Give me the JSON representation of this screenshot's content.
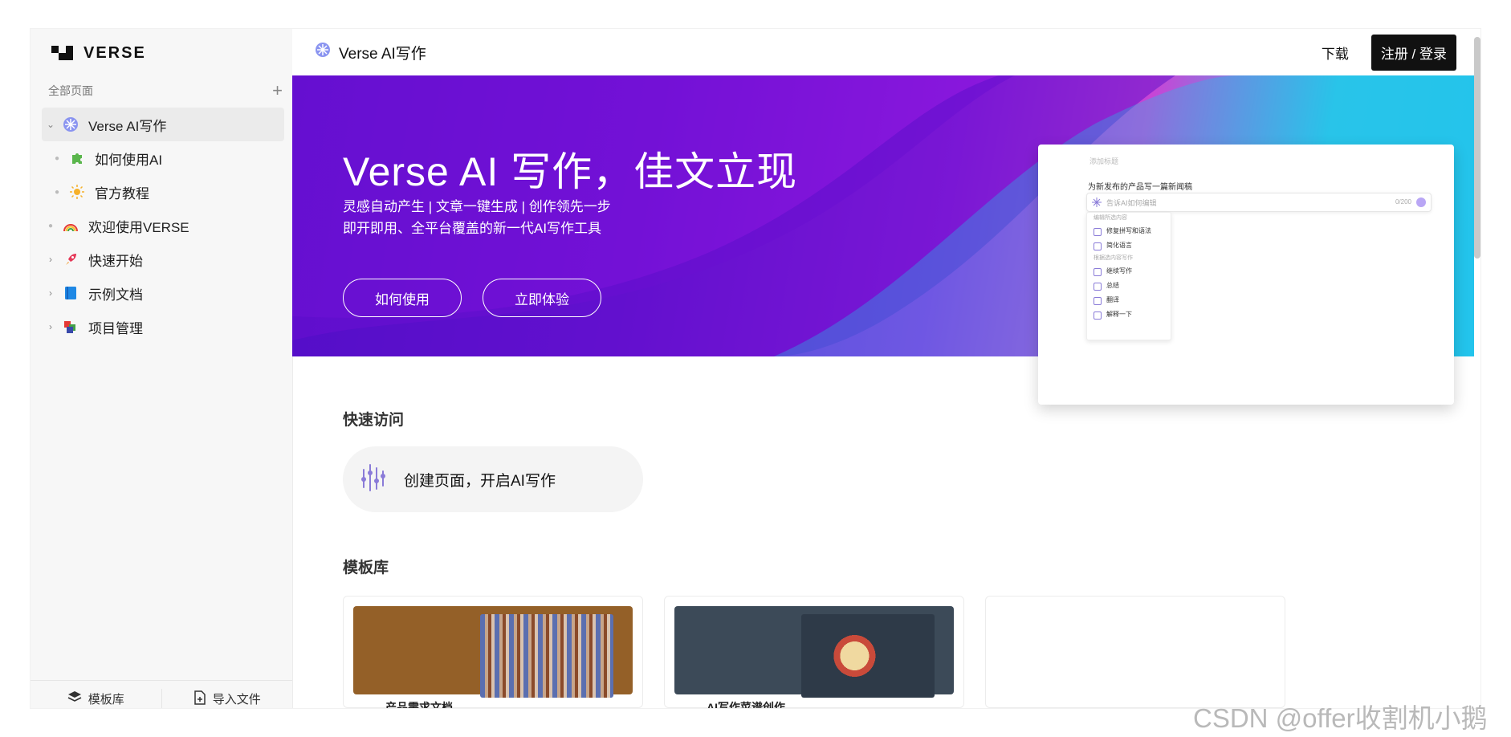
{
  "app": {
    "logo": "VERSE"
  },
  "sidebar": {
    "section_title": "全部页面",
    "add_symbol": "+",
    "items": [
      {
        "label": "Verse AI写作",
        "icon": "verse-ai-icon",
        "caret": "⌄"
      },
      {
        "label": "如何使用AI",
        "icon": "puzzle-icon"
      },
      {
        "label": "官方教程",
        "icon": "sun-icon"
      },
      {
        "label": "欢迎使用VERSE",
        "icon": "rainbow-icon"
      },
      {
        "label": "快速开始",
        "icon": "rocket-icon",
        "caret": "›"
      },
      {
        "label": "示例文档",
        "icon": "book-icon",
        "caret": "›"
      },
      {
        "label": "项目管理",
        "icon": "blocks-icon",
        "caret": "›"
      }
    ],
    "footer": {
      "templates": "模板库",
      "import": "导入文件"
    }
  },
  "header": {
    "title": "Verse AI写作",
    "download": "下载",
    "signup": "注册 / 登录"
  },
  "hero": {
    "title": "Verse AI 写作，佳文立现",
    "subtitle_1": "灵感自动产生 | 文章一键生成 | 创作领先一步",
    "subtitle_2": "即开即用、全平台覆盖的新一代AI写作工具",
    "btn_how": "如何使用",
    "btn_try": "立即体验",
    "preview": {
      "placeholder": "添加标题",
      "doc_title": "为新发布的产品写一篇新闻稿",
      "input_placeholder": "告诉AI如何编辑",
      "counter": "0/200",
      "menu_section_1": "编辑所选内容",
      "menu_items_1": [
        "修复拼写和语法",
        "简化语言"
      ],
      "menu_section_2": "根据选内容写作",
      "menu_items_2": [
        "继续写作",
        "总结",
        "翻译",
        "解释一下"
      ]
    }
  },
  "quick": {
    "heading": "快速访问",
    "create": "创建页面，开启AI写作"
  },
  "templates": {
    "heading": "模板库",
    "cards": [
      {
        "caption": "产品需求文档",
        "band_color": "#946028"
      },
      {
        "caption": "AI写作菜谱创作",
        "band_color": "#3c4a58"
      },
      {
        "caption": ""
      }
    ]
  },
  "watermark": "CSDN @offer收割机小鹅"
}
